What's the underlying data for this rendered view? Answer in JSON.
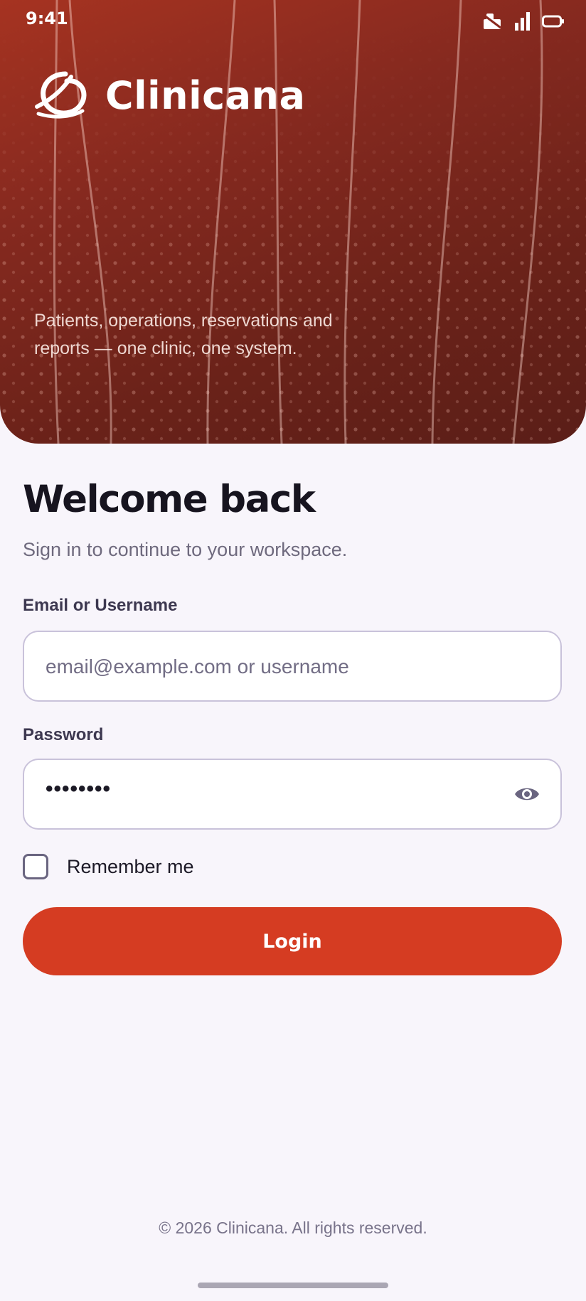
{
  "status_bar": {
    "time": "9:41",
    "icons": [
      "notification-icon",
      "signal-icon",
      "battery-icon"
    ]
  },
  "brand": {
    "name": "Clinicana",
    "logo_icon": "clinicana-logo-icon",
    "tagline": "Patients, operations, reservations and reports — one clinic, one system."
  },
  "form": {
    "title": "Welcome back",
    "subtitle": "Sign in to continue to your workspace.",
    "email_label": "Email or Username",
    "email_placeholder": "email@example.com or username",
    "email_value": "",
    "password_label": "Password",
    "password_masked": "••••••••",
    "password_toggle_icon": "eye-icon",
    "remember_label": "Remember me",
    "remember_checked": false,
    "login_label": "Login"
  },
  "footer": {
    "copyright": "© 2026 Clinicana. All rights reserved."
  },
  "colors": {
    "hero_start": "#a63321",
    "hero_end": "#5a1e18",
    "primary_button": "#d53c22",
    "background": "#f8f5fb",
    "title_text": "#17141f",
    "muted_text": "#6f6a7e"
  }
}
